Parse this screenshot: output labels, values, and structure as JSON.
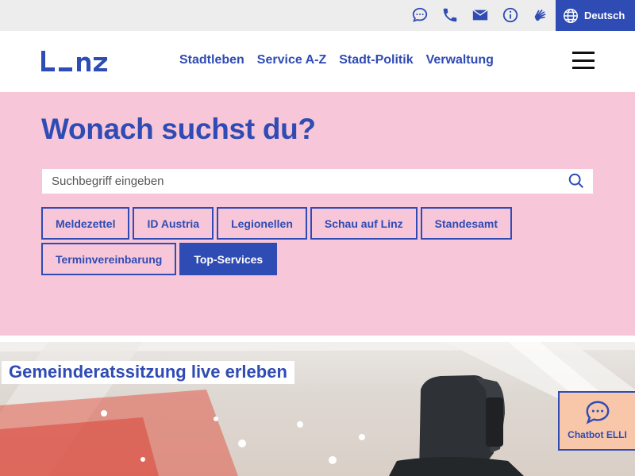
{
  "topbar": {
    "icons": [
      "chat-icon",
      "phone-icon",
      "mail-icon",
      "info-icon",
      "sign-language-icon"
    ],
    "language_label": "Deutsch"
  },
  "header": {
    "logo_text": "Linz",
    "nav": [
      "Stadtleben",
      "Service A-Z",
      "Stadt-Politik",
      "Verwaltung"
    ]
  },
  "hero": {
    "title": "Wonach suchst du?",
    "search_placeholder": "Suchbegriff eingeben",
    "quick_links": [
      {
        "label": "Meldezettel",
        "active": false
      },
      {
        "label": "ID Austria",
        "active": false
      },
      {
        "label": "Legionellen",
        "active": false
      },
      {
        "label": "Schau auf Linz",
        "active": false
      },
      {
        "label": "Standesamt",
        "active": false
      },
      {
        "label": "Terminvereinbarung",
        "active": false
      },
      {
        "label": "Top-Services",
        "active": true
      }
    ]
  },
  "feature": {
    "title": "Gemeinderatssitzung live erleben"
  },
  "chatbot": {
    "label": "Chatbot ELLI"
  },
  "colors": {
    "brand_blue": "#2f4bb4",
    "hero_pink": "#f7c6d8",
    "chatbot_peach": "#f8c7a9",
    "topbar_gray": "#ededed"
  }
}
